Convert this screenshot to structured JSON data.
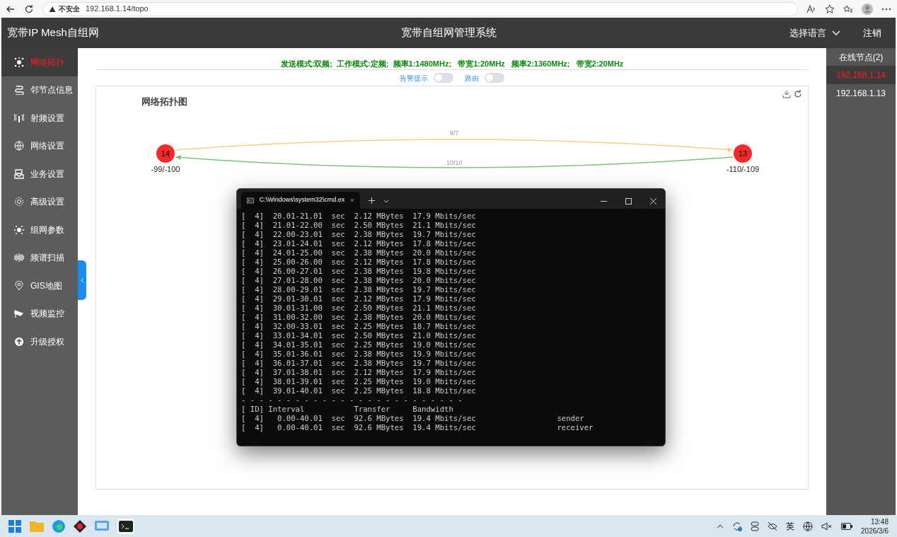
{
  "browser": {
    "security": "不安全",
    "url": "192.168.1.14/topo"
  },
  "header": {
    "brand": "宽带IP Mesh自组网",
    "title": "宽带自组网管理系统",
    "language": "选择语言",
    "logout": "注销"
  },
  "sidebar": {
    "items": [
      {
        "label": "网络拓扑",
        "selected": true
      },
      {
        "label": "邻节点信息",
        "selected": false
      },
      {
        "label": "射频设置",
        "selected": false
      },
      {
        "label": "网络设置",
        "selected": false
      },
      {
        "label": "业务设置",
        "selected": false
      },
      {
        "label": "高级设置",
        "selected": false
      },
      {
        "label": "组网参数",
        "selected": false
      },
      {
        "label": "频谱扫描",
        "selected": false
      },
      {
        "label": "GIS地图",
        "selected": false
      },
      {
        "label": "视频监控",
        "selected": false
      },
      {
        "label": "升级授权",
        "selected": false
      }
    ]
  },
  "info_line": "发送模式:双频;  工作模式:定频;  频率1:1480MHz;   带宽1:20MHz   频率2:1360MHz;   带宽2:20MHz",
  "toggles": [
    {
      "label": "告警提示",
      "on": false
    },
    {
      "label": "路由",
      "on": false
    }
  ],
  "topology": {
    "title": "网络拓扑图",
    "nodes": [
      {
        "label": "14",
        "signal": "-99/-100"
      },
      {
        "label": "13",
        "signal": "-110/-109"
      }
    ],
    "links": [
      {
        "label": "8/7",
        "color": "#f8cf7e"
      },
      {
        "label": "10/10",
        "color": "#7cc576"
      }
    ]
  },
  "online_nodes": {
    "title": "在线节点(2)",
    "items": [
      {
        "label": "192.168.1.14",
        "selected": true
      },
      {
        "label": "192.168.1.13",
        "selected": false
      }
    ]
  },
  "terminal": {
    "tab_title": "C:\\Windows\\system32\\cmd.ex",
    "lines": [
      "[  4]  20.01-21.01  sec  2.12 MBytes  17.9 Mbits/sec",
      "[  4]  21.01-22.00  sec  2.50 MBytes  21.1 Mbits/sec",
      "[  4]  22.00-23.01  sec  2.38 MBytes  19.7 Mbits/sec",
      "[  4]  23.01-24.01  sec  2.12 MBytes  17.8 Mbits/sec",
      "[  4]  24.01-25.00  sec  2.38 MBytes  20.0 Mbits/sec",
      "[  4]  25.00-26.00  sec  2.12 MBytes  17.8 Mbits/sec",
      "[  4]  26.00-27.01  sec  2.38 MBytes  19.8 Mbits/sec",
      "[  4]  27.01-28.00  sec  2.38 MBytes  20.0 Mbits/sec",
      "[  4]  28.00-29.01  sec  2.38 MBytes  19.7 Mbits/sec",
      "[  4]  29.01-30.01  sec  2.12 MBytes  17.9 Mbits/sec",
      "[  4]  30.01-31.00  sec  2.50 MBytes  21.1 Mbits/sec",
      "[  4]  31.00-32.00  sec  2.38 MBytes  20.0 Mbits/sec",
      "[  4]  32.00-33.01  sec  2.25 MBytes  18.7 Mbits/sec",
      "[  4]  33.01-34.01  sec  2.50 MBytes  21.0 Mbits/sec",
      "[  4]  34.01-35.01  sec  2.25 MBytes  19.0 Mbits/sec",
      "[  4]  35.01-36.01  sec  2.38 MBytes  19.9 Mbits/sec",
      "[  4]  36.01-37.01  sec  2.38 MBytes  19.7 Mbits/sec",
      "[  4]  37.01-38.01  sec  2.12 MBytes  17.9 Mbits/sec",
      "[  4]  38.01-39.01  sec  2.25 MBytes  19.0 Mbits/sec",
      "[  4]  39.01-40.01  sec  2.25 MBytes  18.8 Mbits/sec",
      "- - - - - - - - - - - - - - - - - - - - - - - - -",
      "[ ID] Interval           Transfer     Bandwidth",
      "[  4]   0.00-40.01  sec  92.6 MBytes  19.4 Mbits/sec                  sender",
      "[  4]   0.00-40.01  sec  92.6 MBytes  19.4 Mbits/sec                  receiver"
    ]
  },
  "taskbar": {
    "ime": "英",
    "time": "13:48",
    "date": "2026/3/6"
  }
}
